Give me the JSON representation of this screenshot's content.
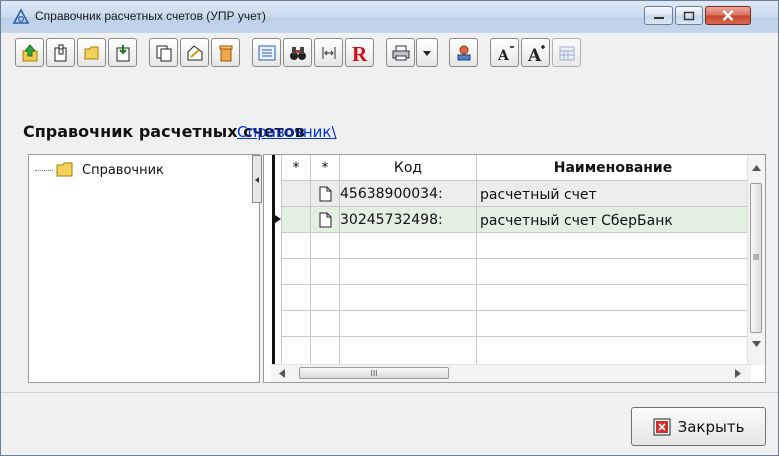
{
  "window": {
    "title": "Справочник расчетных счетов (УПР учет)"
  },
  "heading": {
    "title": "Справочник расчетных счетов",
    "link": "Справочник\\"
  },
  "tree": {
    "items": [
      {
        "label": "Справочник"
      }
    ]
  },
  "grid": {
    "columns": [
      "*",
      "*",
      "Код",
      "Наименование"
    ],
    "rows": [
      {
        "code": "45638900034:",
        "name": "расчетный счет"
      },
      {
        "code": "30245732498:",
        "name": "расчетный счет СберБанк"
      }
    ],
    "hscroll_thumb": "III"
  },
  "buttons": {
    "close": "Закрыть"
  },
  "colors": {
    "selected_row": "#e1f0e1",
    "first_row": "#ececec",
    "link": "#0033dd",
    "close_button_red": "#d0302a"
  }
}
